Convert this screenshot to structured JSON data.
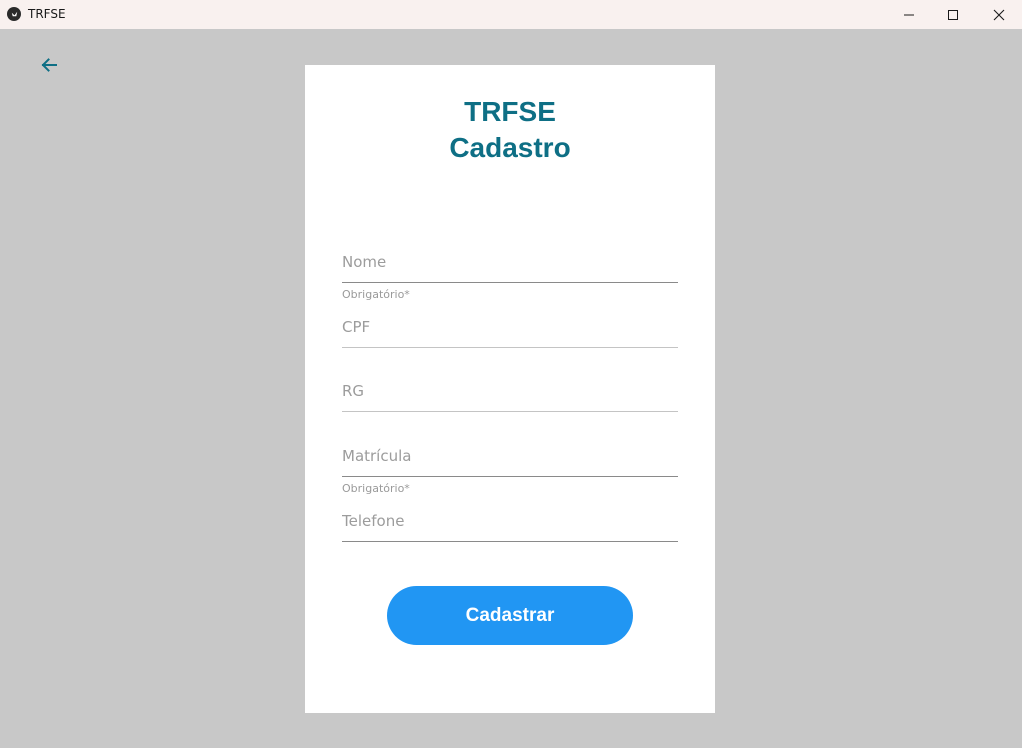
{
  "window": {
    "title": "TRFSE",
    "icons": {
      "app": "kivy-app-icon",
      "minimize": "minimize-icon",
      "maximize": "maximize-icon",
      "close": "close-icon"
    }
  },
  "nav": {
    "back_icon": "arrow-left-icon",
    "accent": "#0e6f85"
  },
  "form": {
    "title_line1": "TRFSE",
    "title_line2": "Cadastro",
    "title_color": "#0e6f85",
    "fields": [
      {
        "placeholder": "Nome",
        "value": "",
        "helper": ""
      },
      {
        "placeholder": "CPF",
        "value": "",
        "helper": "Obrigatório*"
      },
      {
        "placeholder": "RG",
        "value": "",
        "helper": ""
      },
      {
        "placeholder": "Matrícula",
        "value": "",
        "helper": ""
      },
      {
        "placeholder": "Telefone",
        "value": "",
        "helper": "Obrigatório*"
      }
    ],
    "submit_label": "Cadastrar",
    "submit_color": "#2196f3"
  }
}
